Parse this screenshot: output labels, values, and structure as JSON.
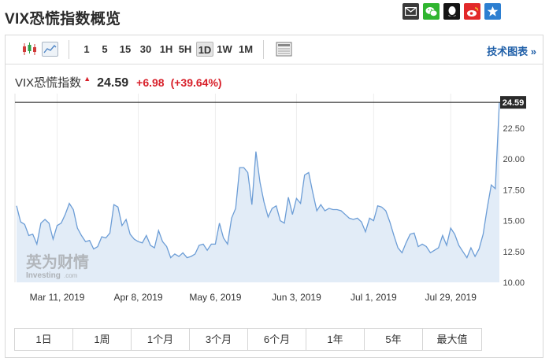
{
  "header": {
    "title": "VIX恐慌指数概览"
  },
  "share_icons": [
    {
      "name": "email-share-icon",
      "bg": "#3a3a3a"
    },
    {
      "name": "wechat-share-icon",
      "bg": "#2fb52f"
    },
    {
      "name": "qq-share-icon",
      "bg": "#141414"
    },
    {
      "name": "weibo-share-icon",
      "bg": "#e2292a"
    },
    {
      "name": "qzone-share-icon",
      "bg": "#2d7fd1"
    }
  ],
  "toolbar": {
    "chart_type_icons": [
      "candlestick-chart-icon",
      "area-chart-icon"
    ],
    "intervals": [
      {
        "label": "1",
        "active": false
      },
      {
        "label": "5",
        "active": false
      },
      {
        "label": "15",
        "active": false
      },
      {
        "label": "30",
        "active": false
      },
      {
        "label": "1H",
        "active": false
      },
      {
        "label": "5H",
        "active": false
      },
      {
        "label": "1D",
        "active": true
      },
      {
        "label": "1W",
        "active": false
      },
      {
        "label": "1M",
        "active": false
      }
    ],
    "table_icon": "data-table-icon",
    "tech_chart_label": "技术图表 »"
  },
  "quote": {
    "name": "VIX恐慌指数",
    "price": "24.59",
    "change": "+6.98",
    "change_pct": "(+39.64%)",
    "up_color": "#d8202a"
  },
  "watermark": {
    "cn": "英为财情",
    "en": "Investing",
    "suffix": ".com"
  },
  "range_buttons": [
    "1日",
    "1周",
    "1个月",
    "3个月",
    "6个月",
    "1年",
    "5年",
    "最大值"
  ],
  "chart_data": {
    "type": "area",
    "line_color": "#6c9dd6",
    "fill_color": "#e2ecf7",
    "y_tick_labels": [
      "10.00",
      "12.50",
      "15.00",
      "17.50",
      "20.00",
      "22.50"
    ],
    "y_ticks": [
      10,
      12.5,
      15,
      17.5,
      20,
      22.5
    ],
    "ylim": [
      10,
      25.3
    ],
    "x_tick_labels": [
      "Mar 11, 2019",
      "Apr 8, 2019",
      "May 6, 2019",
      "Jun 3, 2019",
      "Jul 1, 2019",
      "Jul 29, 2019"
    ],
    "x_tick_index": [
      10,
      30,
      49,
      69,
      88,
      107
    ],
    "last_value_label": "24.59",
    "grid": "vertical",
    "values": [
      16.2,
      14.9,
      14.7,
      13.8,
      13.9,
      13.1,
      14.8,
      15.1,
      14.8,
      13.5,
      14.6,
      14.8,
      15.5,
      16.4,
      15.9,
      14.4,
      13.8,
      13.3,
      13.4,
      12.7,
      12.9,
      13.7,
      13.6,
      14.0,
      16.3,
      16.1,
      14.6,
      15.1,
      13.9,
      13.5,
      13.3,
      13.2,
      13.8,
      13.0,
      12.8,
      14.2,
      13.3,
      12.9,
      12.0,
      12.3,
      12.1,
      12.4,
      12.0,
      12.1,
      12.3,
      13.0,
      13.1,
      12.6,
      13.1,
      13.1,
      14.8,
      13.6,
      13.1,
      15.2,
      16.0,
      19.3,
      19.3,
      18.9,
      16.3,
      20.6,
      18.1,
      16.5,
      15.3,
      16.0,
      16.2,
      15.0,
      14.8,
      16.9,
      15.5,
      16.8,
      16.4,
      18.7,
      18.9,
      17.3,
      15.8,
      16.3,
      15.8,
      16.0,
      15.9,
      15.9,
      15.8,
      15.5,
      15.2,
      15.1,
      15.2,
      14.9,
      14.1,
      15.2,
      15.0,
      16.2,
      16.1,
      15.8,
      14.9,
      13.8,
      12.8,
      12.4,
      13.2,
      13.9,
      14.0,
      12.9,
      13.1,
      12.9,
      12.4,
      12.6,
      12.8,
      13.8,
      13.0,
      14.4,
      13.9,
      13.0,
      12.5,
      12.0,
      12.8,
      12.1,
      12.7,
      13.9,
      16.0,
      17.9,
      17.6,
      24.59
    ]
  }
}
